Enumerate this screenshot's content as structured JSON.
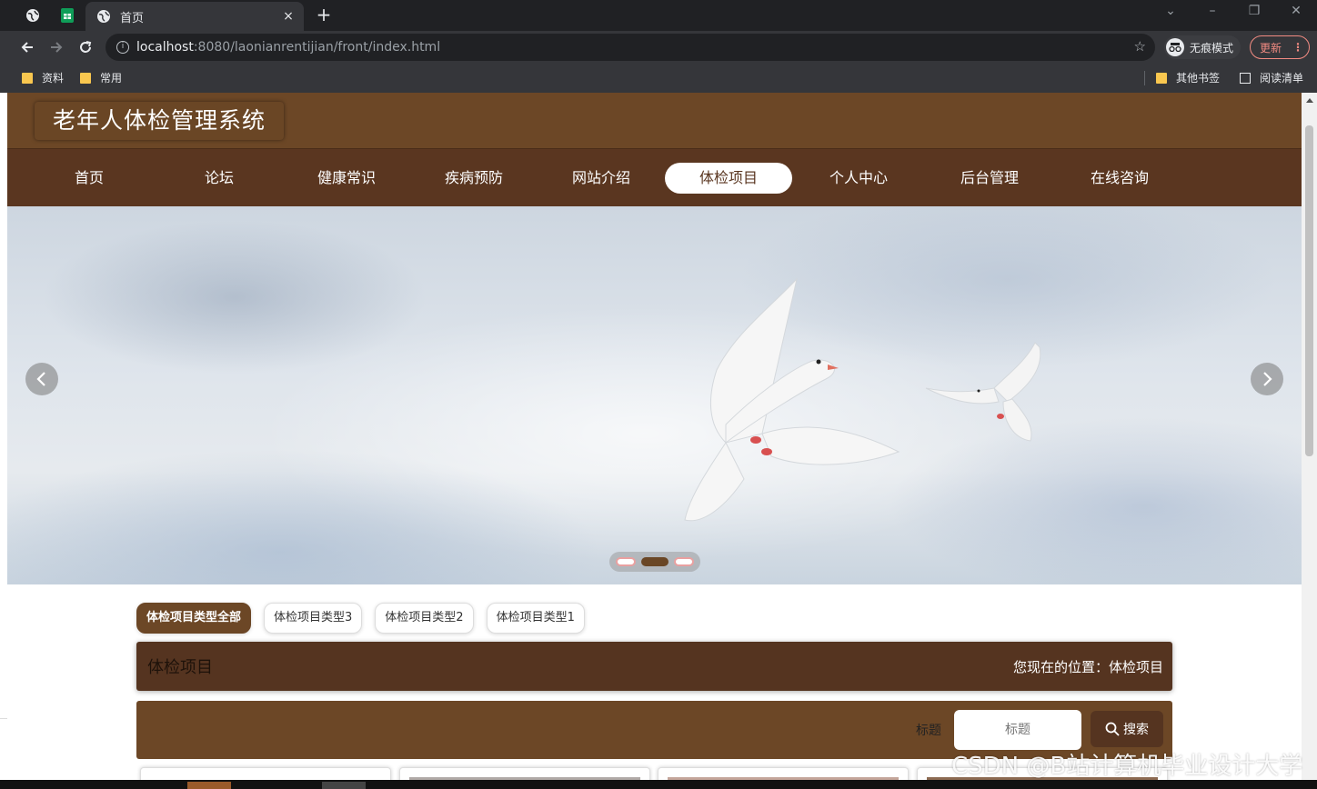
{
  "browser": {
    "tab_title": "首页",
    "new_tab": "+",
    "tab_close": "×",
    "url_host": "localhost",
    "url_path": ":8080/laonianrentijian/front/index.html",
    "incognito_label": "无痕模式",
    "update_label": "更新",
    "bookmarks": [
      "资料",
      "常用"
    ],
    "other_bookmarks": "其他书签",
    "reading_list": "阅读清单"
  },
  "site": {
    "title": "老年人体检管理系统",
    "nav": [
      "首页",
      "论坛",
      "健康常识",
      "疾病预防",
      "网站介绍",
      "体检项目",
      "个人中心",
      "后台管理",
      "在线咨询"
    ],
    "active_nav": "体检项目"
  },
  "banner": {
    "slide_count": 3,
    "active_slide": 2
  },
  "filters": [
    "体检项目类型全部",
    "体检项目类型3",
    "体检项目类型2",
    "体检项目类型1"
  ],
  "section": {
    "title": "体检项目",
    "location": "您现在的位置：体检项目"
  },
  "search": {
    "label": "标题",
    "placeholder": "标题",
    "button": "搜索"
  },
  "watermark": "CSDN @B站计算机毕业设计大学",
  "colors": {
    "header_brown": "#6c4726",
    "nav_brown": "#5a3620",
    "title_bar_brown": "#553420"
  }
}
